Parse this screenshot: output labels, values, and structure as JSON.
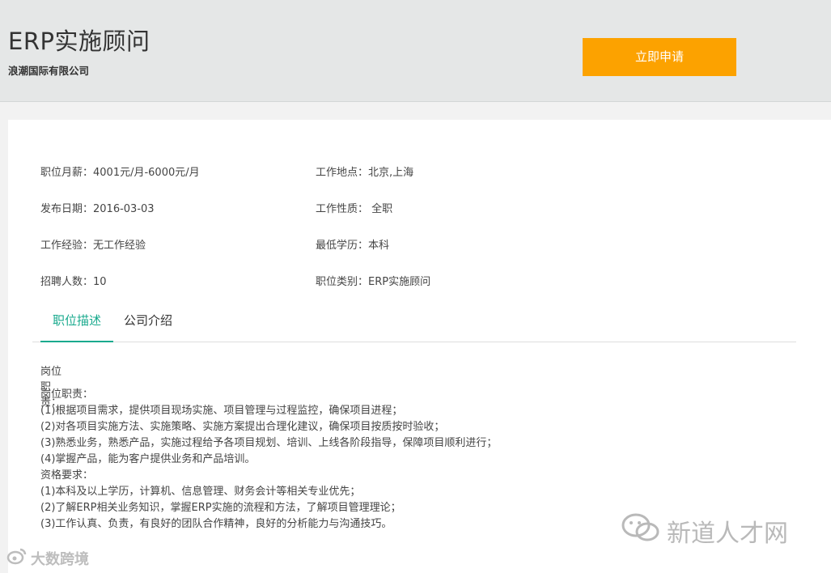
{
  "header": {
    "job_title": "ERP实施顾问",
    "company": "浪潮国际有限公司",
    "apply_label": "立即申请"
  },
  "info": {
    "salary": "职位月薪：4001元/月-6000元/月",
    "location": "工作地点：北京,上海",
    "publish_date": "发布日期：2016-03-03",
    "job_type": "工作性质： 全职",
    "experience": "工作经验：无工作经验",
    "education": "最低学历：本科",
    "headcount": "招聘人数：10",
    "category": "职位类别：ERP实施顾问"
  },
  "tabs": [
    {
      "label": "职位描述",
      "active": true
    },
    {
      "label": "公司介绍",
      "active": false
    }
  ],
  "description": {
    "heading": "岗位职责：",
    "lines": [
      "岗位职责：",
      "(1)根据项目需求，提供项目现场实施、项目管理与过程监控，确保项目进程；",
      "(2)对各项目实施方法、实施策略、实施方案提出合理化建议，确保项目按质按时验收；",
      "(3)熟悉业务，熟悉产品，实施过程给予各项目规划、培训、上线各阶段指导，保障项目顺利进行；",
      "(4)掌握产品，能为客户提供业务和产品培训。",
      "资格要求：",
      "(1)本科及以上学历，计算机、信息管理、财务会计等相关专业优先；",
      "(2)了解ERP相关业务知识，掌握ERP实施的流程和方法，了解项目管理理论；",
      "(3)工作认真、负责，有良好的团队合作精神，良好的分析能力与沟通技巧。"
    ]
  },
  "watermarks": {
    "right": "新道人才网",
    "left": "大数跨境",
    "right_icon": "wechat-icon",
    "left_icon": "weibo-icon"
  },
  "colors": {
    "accent": "#1aaa8e",
    "apply_button": "#fca200",
    "header_bg": "#e5e7e7"
  }
}
